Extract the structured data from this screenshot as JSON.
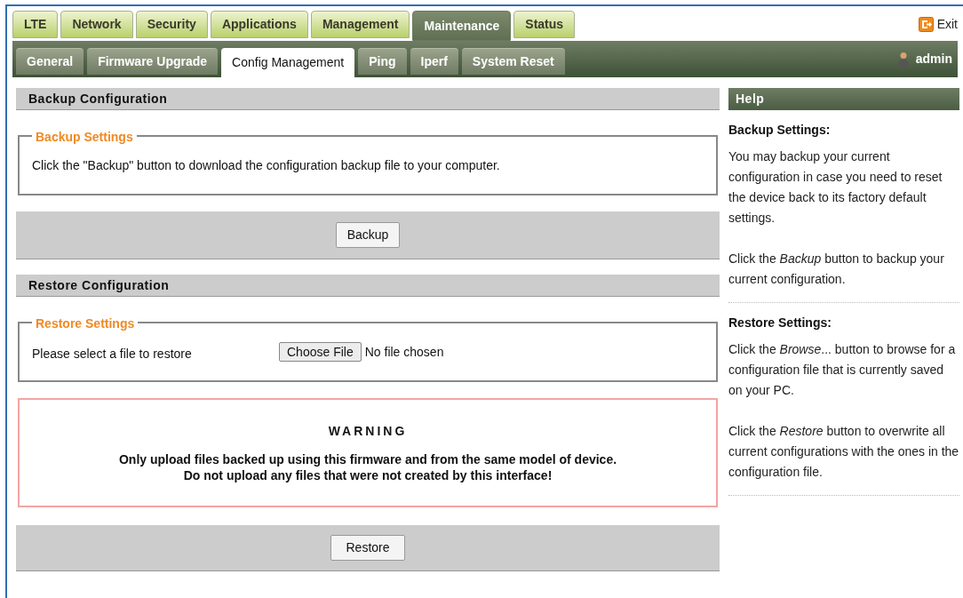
{
  "main_tabs": [
    {
      "label": "LTE",
      "selected": false
    },
    {
      "label": "Network",
      "selected": false
    },
    {
      "label": "Security",
      "selected": false
    },
    {
      "label": "Applications",
      "selected": false
    },
    {
      "label": "Management",
      "selected": false
    },
    {
      "label": "Maintenance",
      "selected": true
    },
    {
      "label": "Status",
      "selected": false
    }
  ],
  "exit": {
    "label": "Exit"
  },
  "sub_tabs": [
    {
      "label": "General",
      "selected": false
    },
    {
      "label": "Firmware Upgrade",
      "selected": false
    },
    {
      "label": "Config Management",
      "selected": true
    },
    {
      "label": "Ping",
      "selected": false
    },
    {
      "label": "Iperf",
      "selected": false
    },
    {
      "label": "System Reset",
      "selected": false
    }
  ],
  "user": {
    "name": "admin"
  },
  "backup": {
    "title": "Backup Configuration",
    "legend": "Backup Settings",
    "text": "Click the \"Backup\" button to download the configuration backup file to your computer.",
    "button": "Backup"
  },
  "restore": {
    "title": "Restore Configuration",
    "legend": "Restore Settings",
    "label": "Please select a file to restore",
    "file_button": "Choose File",
    "file_status": "No file chosen",
    "warning_title": "WARNING",
    "warning_lines": [
      "Only upload files backed up using this firmware and from the same model of device.",
      "Do not upload any files that were not created by this interface!"
    ],
    "button": "Restore"
  },
  "help": {
    "title": "Help",
    "sections": [
      {
        "heading": "Backup Settings:",
        "paragraphs": [
          "You may backup your current configuration in case you need to reset the device back to its factory default settings.",
          "Click the *Backup* button to backup your current configuration."
        ]
      },
      {
        "heading": "Restore Settings:",
        "paragraphs": [
          "Click the *Browse*... button to browse for a configuration file that is currently saved on your PC.",
          "Click the *Restore* button to overwrite all current configurations with the ones in the configuration file."
        ]
      }
    ]
  }
}
